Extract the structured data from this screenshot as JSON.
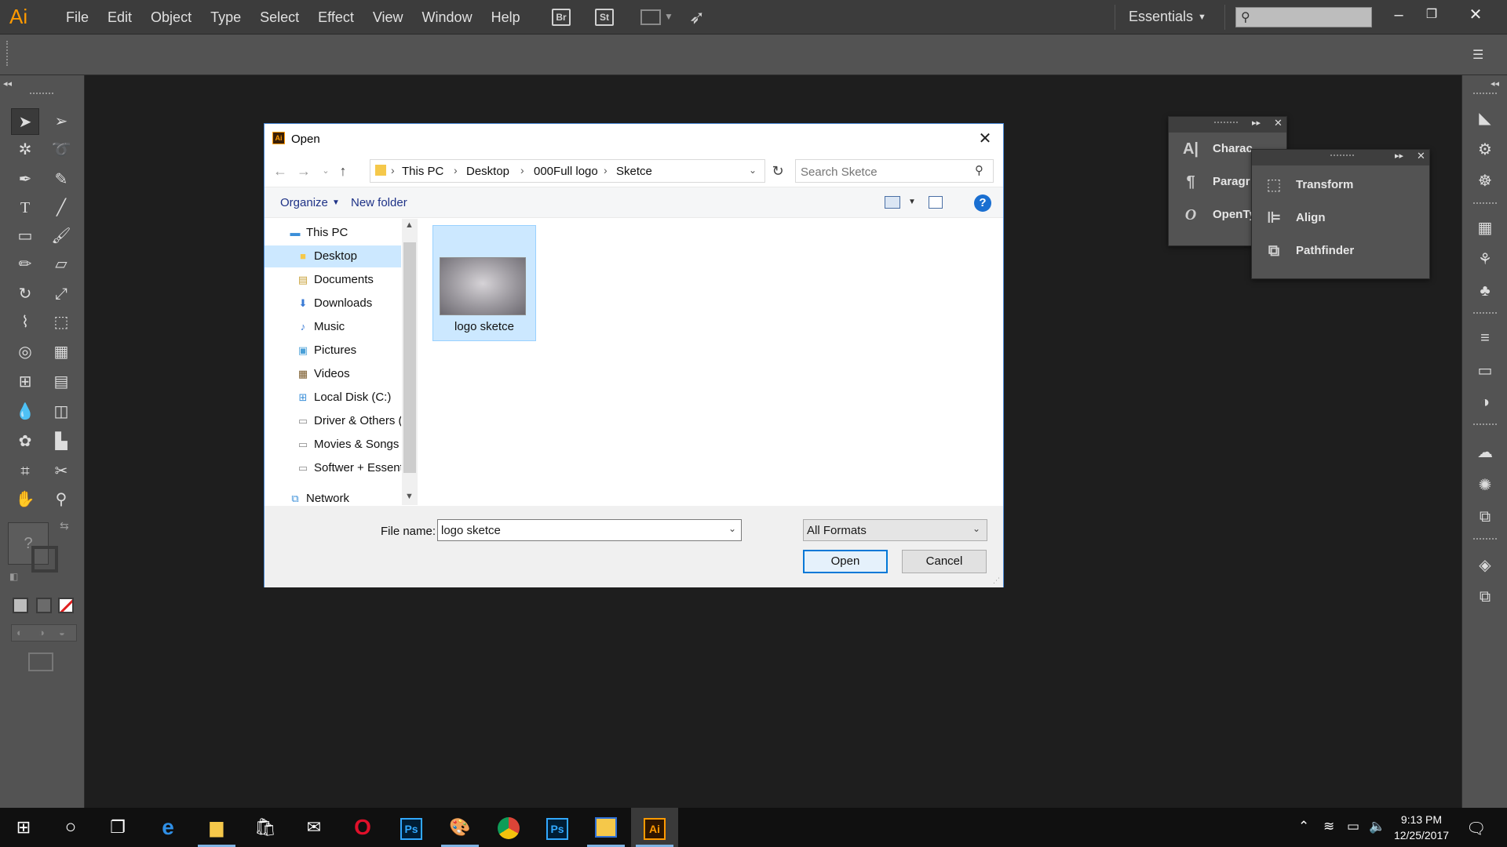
{
  "app": {
    "logo_text": "Ai",
    "brand_color": "#ff9a00",
    "menu": [
      "File",
      "Edit",
      "Object",
      "Type",
      "Select",
      "Effect",
      "View",
      "Window",
      "Help"
    ],
    "bridge_label": "Br",
    "stock_label": "St",
    "workspace": "Essentials",
    "search_placeholder": "",
    "window_controls": [
      "minimize-icon",
      "restore-icon",
      "close-icon"
    ]
  },
  "tools": [
    "selection",
    "direct-selection",
    "magic-wand",
    "lasso",
    "pen",
    "curvature",
    "type",
    "line-segment",
    "rectangle",
    "paintbrush",
    "pencil",
    "eraser",
    "rotate",
    "scale",
    "width",
    "free-transform",
    "shape-builder",
    "perspective-grid",
    "mesh",
    "gradient",
    "eyedropper",
    "blend",
    "symbol-sprayer",
    "column-graph",
    "artboard",
    "slice",
    "hand",
    "zoom"
  ],
  "color_placeholder": "?",
  "panels": {
    "type_panel": {
      "rows": [
        {
          "icon": "character-icon",
          "glyph": "A|",
          "label": "Charac"
        },
        {
          "icon": "paragraph-icon",
          "glyph": "¶",
          "label": "Paragr"
        },
        {
          "icon": "opentype-icon",
          "glyph": "O",
          "label": "OpenTy"
        }
      ]
    },
    "transform_panel": {
      "rows": [
        {
          "icon": "transform-icon",
          "label": "Transform"
        },
        {
          "icon": "align-icon",
          "label": "Align"
        },
        {
          "icon": "pathfinder-icon",
          "label": "Pathfinder"
        }
      ]
    }
  },
  "dialog": {
    "title": "Open",
    "breadcrumb": [
      "This PC",
      "Desktop",
      "000Full logo",
      "Sketce"
    ],
    "search_placeholder": "Search Sketce",
    "toolbar": {
      "organize": "Organize",
      "new_folder": "New folder",
      "help": "?"
    },
    "nav": [
      {
        "label": "This PC",
        "icon": "pc-icon",
        "level": 0,
        "selected": false
      },
      {
        "label": "Desktop",
        "icon": "folder-icon",
        "level": 1,
        "selected": true
      },
      {
        "label": "Documents",
        "icon": "documents-icon",
        "level": 1,
        "selected": false
      },
      {
        "label": "Downloads",
        "icon": "downloads-icon",
        "level": 1,
        "selected": false
      },
      {
        "label": "Music",
        "icon": "music-icon",
        "level": 1,
        "selected": false
      },
      {
        "label": "Pictures",
        "icon": "pictures-icon",
        "level": 1,
        "selected": false
      },
      {
        "label": "Videos",
        "icon": "videos-icon",
        "level": 1,
        "selected": false
      },
      {
        "label": "Local Disk (C:)",
        "icon": "windows-drive-icon",
        "level": 1,
        "selected": false
      },
      {
        "label": "Driver & Others (",
        "icon": "drive-icon",
        "level": 1,
        "selected": false
      },
      {
        "label": "Movies  & Songs",
        "icon": "drive-icon",
        "level": 1,
        "selected": false
      },
      {
        "label": "Softwer + Essent",
        "icon": "drive-icon",
        "level": 1,
        "selected": false
      },
      {
        "label": "Network",
        "icon": "network-icon",
        "level": 0,
        "selected": false
      }
    ],
    "files": [
      {
        "name": "logo sketce",
        "selected": true
      }
    ],
    "file_name_label": "File name:",
    "file_name_value": "logo sketce",
    "format_value": "All Formats",
    "open_label": "Open",
    "cancel_label": "Cancel"
  },
  "taskbar": {
    "apps": [
      "start-icon",
      "cortana-icon",
      "task-view-icon",
      "edge-icon",
      "file-explorer-icon",
      "store-icon",
      "mail-icon",
      "opera-icon",
      "photoshop-icon",
      "paint-icon",
      "chrome-icon",
      "photoshop-icon-2",
      "photo-viewer-icon",
      "illustrator-icon"
    ],
    "ps_label": "Ps",
    "ai_label": "Ai",
    "time": "9:13 PM",
    "date": "12/25/2017"
  }
}
